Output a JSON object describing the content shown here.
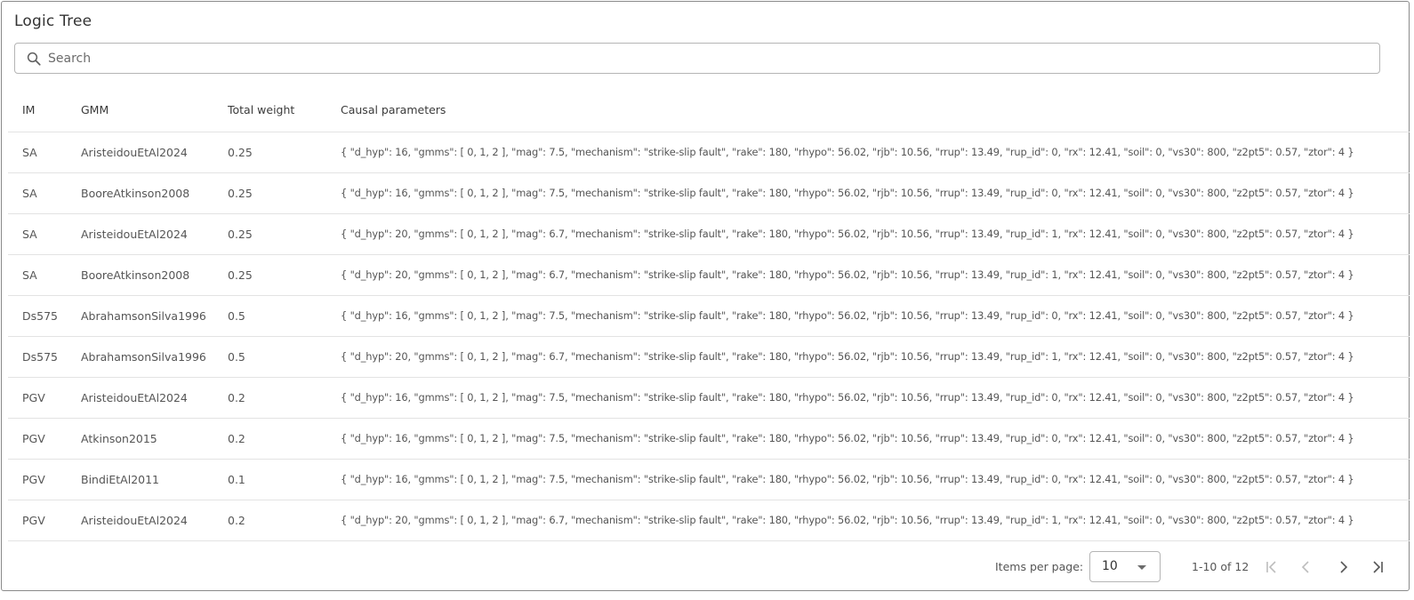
{
  "title": "Logic Tree",
  "search": {
    "placeholder": "Search",
    "value": ""
  },
  "table": {
    "columns": [
      "IM",
      "GMM",
      "Total weight",
      "Causal parameters"
    ],
    "rows": [
      {
        "im": "SA",
        "gmm": "AristeidouEtAl2024",
        "weight": "0.25",
        "params": "{ \"d_hyp\": 16, \"gmms\": [ 0, 1, 2 ], \"mag\": 7.5, \"mechanism\": \"strike-slip fault\", \"rake\": 180, \"rhypo\": 56.02, \"rjb\": 10.56, \"rrup\": 13.49, \"rup_id\": 0, \"rx\": 12.41, \"soil\": 0, \"vs30\": 800, \"z2pt5\": 0.57, \"ztor\": 4 }"
      },
      {
        "im": "SA",
        "gmm": "BooreAtkinson2008",
        "weight": "0.25",
        "params": "{ \"d_hyp\": 16, \"gmms\": [ 0, 1, 2 ], \"mag\": 7.5, \"mechanism\": \"strike-slip fault\", \"rake\": 180, \"rhypo\": 56.02, \"rjb\": 10.56, \"rrup\": 13.49, \"rup_id\": 0, \"rx\": 12.41, \"soil\": 0, \"vs30\": 800, \"z2pt5\": 0.57, \"ztor\": 4 }"
      },
      {
        "im": "SA",
        "gmm": "AristeidouEtAl2024",
        "weight": "0.25",
        "params": "{ \"d_hyp\": 20, \"gmms\": [ 0, 1, 2 ], \"mag\": 6.7, \"mechanism\": \"strike-slip fault\", \"rake\": 180, \"rhypo\": 56.02, \"rjb\": 10.56, \"rrup\": 13.49, \"rup_id\": 1, \"rx\": 12.41, \"soil\": 0, \"vs30\": 800, \"z2pt5\": 0.57, \"ztor\": 4 }"
      },
      {
        "im": "SA",
        "gmm": "BooreAtkinson2008",
        "weight": "0.25",
        "params": "{ \"d_hyp\": 20, \"gmms\": [ 0, 1, 2 ], \"mag\": 6.7, \"mechanism\": \"strike-slip fault\", \"rake\": 180, \"rhypo\": 56.02, \"rjb\": 10.56, \"rrup\": 13.49, \"rup_id\": 1, \"rx\": 12.41, \"soil\": 0, \"vs30\": 800, \"z2pt5\": 0.57, \"ztor\": 4 }"
      },
      {
        "im": "Ds575",
        "gmm": "AbrahamsonSilva1996",
        "weight": "0.5",
        "params": "{ \"d_hyp\": 16, \"gmms\": [ 0, 1, 2 ], \"mag\": 7.5, \"mechanism\": \"strike-slip fault\", \"rake\": 180, \"rhypo\": 56.02, \"rjb\": 10.56, \"rrup\": 13.49, \"rup_id\": 0, \"rx\": 12.41, \"soil\": 0, \"vs30\": 800, \"z2pt5\": 0.57, \"ztor\": 4 }"
      },
      {
        "im": "Ds575",
        "gmm": "AbrahamsonSilva1996",
        "weight": "0.5",
        "params": "{ \"d_hyp\": 20, \"gmms\": [ 0, 1, 2 ], \"mag\": 6.7, \"mechanism\": \"strike-slip fault\", \"rake\": 180, \"rhypo\": 56.02, \"rjb\": 10.56, \"rrup\": 13.49, \"rup_id\": 1, \"rx\": 12.41, \"soil\": 0, \"vs30\": 800, \"z2pt5\": 0.57, \"ztor\": 4 }"
      },
      {
        "im": "PGV",
        "gmm": "AristeidouEtAl2024",
        "weight": "0.2",
        "params": "{ \"d_hyp\": 16, \"gmms\": [ 0, 1, 2 ], \"mag\": 7.5, \"mechanism\": \"strike-slip fault\", \"rake\": 180, \"rhypo\": 56.02, \"rjb\": 10.56, \"rrup\": 13.49, \"rup_id\": 0, \"rx\": 12.41, \"soil\": 0, \"vs30\": 800, \"z2pt5\": 0.57, \"ztor\": 4 }"
      },
      {
        "im": "PGV",
        "gmm": "Atkinson2015",
        "weight": "0.2",
        "params": "{ \"d_hyp\": 16, \"gmms\": [ 0, 1, 2 ], \"mag\": 7.5, \"mechanism\": \"strike-slip fault\", \"rake\": 180, \"rhypo\": 56.02, \"rjb\": 10.56, \"rrup\": 13.49, \"rup_id\": 0, \"rx\": 12.41, \"soil\": 0, \"vs30\": 800, \"z2pt5\": 0.57, \"ztor\": 4 }"
      },
      {
        "im": "PGV",
        "gmm": "BindiEtAl2011",
        "weight": "0.1",
        "params": "{ \"d_hyp\": 16, \"gmms\": [ 0, 1, 2 ], \"mag\": 7.5, \"mechanism\": \"strike-slip fault\", \"rake\": 180, \"rhypo\": 56.02, \"rjb\": 10.56, \"rrup\": 13.49, \"rup_id\": 0, \"rx\": 12.41, \"soil\": 0, \"vs30\": 800, \"z2pt5\": 0.57, \"ztor\": 4 }"
      },
      {
        "im": "PGV",
        "gmm": "AristeidouEtAl2024",
        "weight": "0.2",
        "params": "{ \"d_hyp\": 20, \"gmms\": [ 0, 1, 2 ], \"mag\": 6.7, \"mechanism\": \"strike-slip fault\", \"rake\": 180, \"rhypo\": 56.02, \"rjb\": 10.56, \"rrup\": 13.49, \"rup_id\": 1, \"rx\": 12.41, \"soil\": 0, \"vs30\": 800, \"z2pt5\": 0.57, \"ztor\": 4 }"
      }
    ]
  },
  "paginator": {
    "items_per_page_label": "Items per page:",
    "items_per_page_value": "10",
    "range_label": "1-10 of 12"
  },
  "icons": {
    "search": "search-icon",
    "dropdown": "chevron-down-icon",
    "first": "first-page-icon",
    "prev": "chevron-left-icon",
    "next": "chevron-right-icon",
    "last": "last-page-icon"
  },
  "colors": {
    "border": "#8a8a8a",
    "row_divider": "#e3e3e3",
    "text": "#555555",
    "icon_disabled": "#bdbdbd",
    "icon_enabled": "#555555"
  }
}
